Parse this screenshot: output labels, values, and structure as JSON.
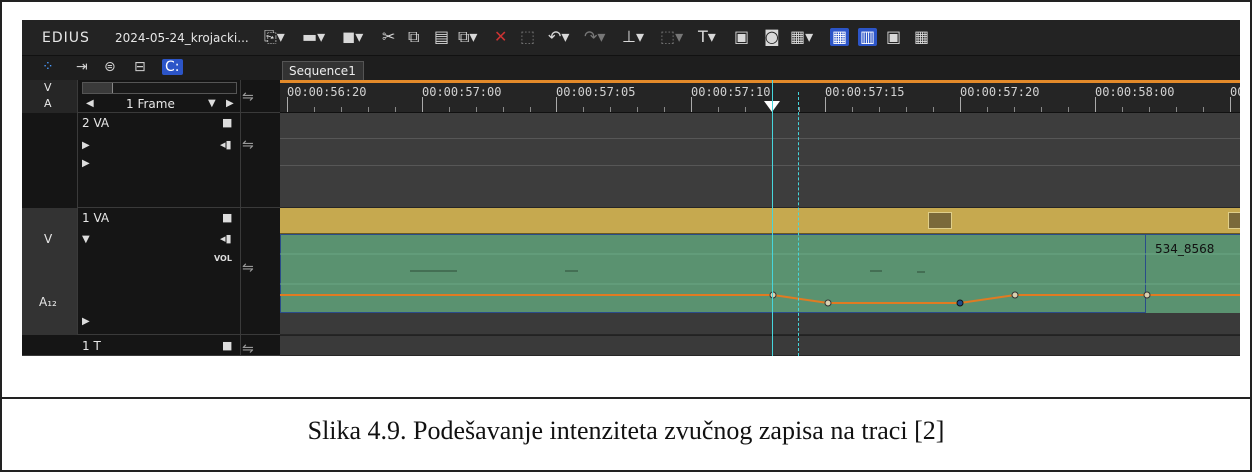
{
  "toolbar": {
    "app_name": "EDIUS",
    "project_name": "2024-05-24_krojacki..."
  },
  "timeline": {
    "tab_label": "Sequence1",
    "timecodes": [
      "00:00:56:20",
      "00:00:57:00",
      "00:00:57:05",
      "00:00:57:10",
      "00:00:57:15",
      "00:00:57:20",
      "00:00:58:00",
      "00"
    ]
  },
  "header": {
    "v_label": "V",
    "a_label": "A",
    "frame_label": "1 Frame"
  },
  "tracks": {
    "track_2va": {
      "label": "2 VA"
    },
    "track_1va": {
      "label": "1 VA",
      "v_label": "V",
      "a_label": "A₁₂",
      "vol_label": "VOL"
    },
    "track_1t": {
      "label": "1 T"
    }
  },
  "clip_audio_2_label": "534_8568",
  "colors": {
    "video_clip": "#c6a94f",
    "audio_clip": "#5a9270",
    "rubber_band": "#e07b22",
    "timecode_cursor": "#46d6dc",
    "ruler_in_out": "#e38a2a"
  },
  "caption": "Slika 4.9. Podešavanje intenziteta zvučnog zapisa na traci [2]"
}
